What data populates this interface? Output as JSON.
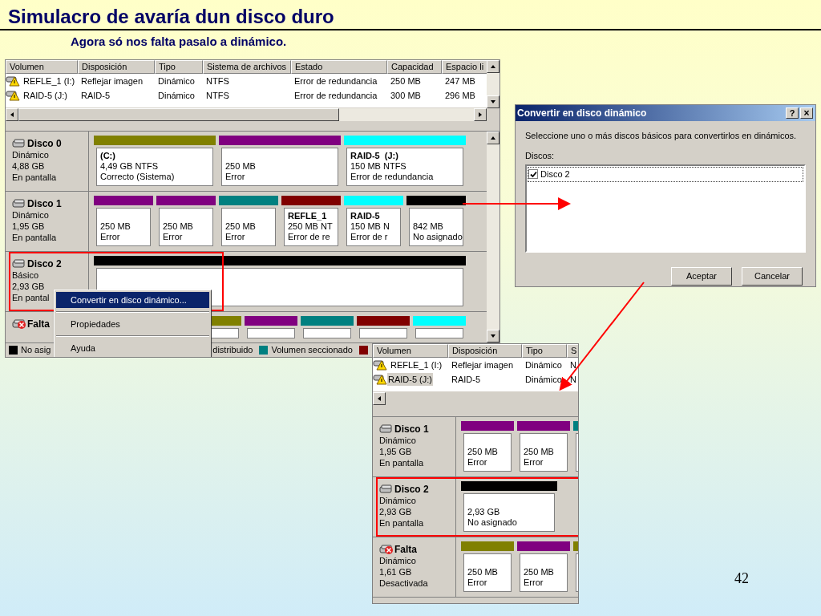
{
  "slide": {
    "title": "Simulacro de avaría dun disco duro",
    "subtitle": "Agora só nos falta pasalo a dinámico.",
    "page_number": "42"
  },
  "main_window": {
    "columns": [
      "Volumen",
      "Disposición",
      "Tipo",
      "Sistema de archivos",
      "Estado",
      "Capacidad",
      "Espacio li"
    ],
    "rows": [
      {
        "cells": [
          "REFLE_1 (I:)",
          "Reflejar imagen",
          "Dinámico",
          "NTFS",
          "Error de redundancia",
          "250 MB",
          "247 MB"
        ],
        "selected": false
      },
      {
        "cells": [
          "RAID-5 (J:)",
          "RAID-5",
          "Dinámico",
          "NTFS",
          "Error de redundancia",
          "300 MB",
          "296 MB"
        ],
        "selected": false
      }
    ],
    "disks": [
      {
        "name": "Disco 0",
        "missing": false,
        "highlighted": false,
        "lines": [
          "Dinámico",
          "4,88 GB",
          "En pantalla"
        ],
        "partitions": [
          {
            "color": "#808000",
            "title": "(C:)",
            "lines": [
              "4,49 GB NTFS",
              "Correcto (Sistema)"
            ]
          },
          {
            "color": "#800080",
            "lines": [
              "250 MB",
              "Error"
            ]
          },
          {
            "color": "#00ffff",
            "title": "RAID-5  (J:)",
            "lines": [
              "150 MB NTFS",
              "Error de redundancia"
            ]
          }
        ]
      },
      {
        "name": "Disco 1",
        "missing": false,
        "highlighted": false,
        "lines": [
          "Dinámico",
          "1,95 GB",
          "En pantalla"
        ],
        "partitions": [
          {
            "color": "#800080",
            "lines": [
              "250 MB",
              "Error"
            ]
          },
          {
            "color": "#800080",
            "lines": [
              "250 MB",
              "Error"
            ]
          },
          {
            "color": "#008080",
            "lines": [
              "250 MB",
              "Error"
            ]
          },
          {
            "color": "#800000",
            "title": "REFLE_1",
            "lines": [
              "250 MB NT",
              "Error de re"
            ]
          },
          {
            "color": "#00ffff",
            "title": "RAID-5",
            "lines": [
              "150 MB N",
              "Error de r"
            ]
          },
          {
            "color": "#000000",
            "lines": [
              "842 MB",
              "No asignado"
            ]
          }
        ]
      },
      {
        "name": "Disco 2",
        "missing": false,
        "highlighted": true,
        "lines": [
          "Básico",
          "2,93 GB",
          "En pantal"
        ],
        "partitions": [
          {
            "color": "#000000"
          }
        ]
      },
      {
        "name": "Falta",
        "missing": true,
        "highlighted": false,
        "partitions": [
          {
            "color": "#808000"
          },
          {
            "color": "#800080"
          },
          {
            "color": "#008080"
          },
          {
            "color": "#800000"
          },
          {
            "color": "#00ffff"
          }
        ]
      }
    ],
    "legend": [
      {
        "color": "#000000",
        "label": "No asig"
      },
      {
        "label": "distribuido"
      },
      {
        "color": "#008080",
        "label": "Volumen seccionado"
      },
      {
        "color": "#800000"
      }
    ],
    "context_menu": {
      "items": [
        {
          "label": "Convertir en disco dinámico...",
          "selected": true
        },
        {
          "label": "Propiedades",
          "selected": false
        },
        {
          "label": "Ayuda",
          "selected": false
        }
      ]
    }
  },
  "dialog": {
    "title": "Convertir en disco dinámico",
    "help": "?",
    "close": "×",
    "prompt": "Seleccione uno o más discos básicos para convertirlos en dinámicos.",
    "list_label": "Discos:",
    "disks": [
      {
        "label": "Disco 2",
        "checked": true
      }
    ],
    "buttons": [
      "Aceptar",
      "Cancelar"
    ]
  },
  "zoom_window": {
    "columns": [
      "Volumen",
      "Disposición",
      "Tipo",
      "S"
    ],
    "rows": [
      {
        "cells": [
          "REFLE_1 (I:)",
          "Reflejar imagen",
          "Dinámico",
          "N"
        ],
        "selected": false
      },
      {
        "cells": [
          "RAID-5 (J:)",
          "RAID-5",
          "Dinámico",
          "N"
        ],
        "selected": true
      }
    ],
    "disks": [
      {
        "name": "Disco 1",
        "missing": false,
        "highlighted": false,
        "lines": [
          "Dinámico",
          "1,95 GB",
          "En pantalla"
        ],
        "partitions": [
          {
            "color": "#800080",
            "lines": [
              "250 MB",
              "Error"
            ]
          },
          {
            "color": "#800080",
            "lines": [
              "250 MB",
              "Error"
            ]
          },
          {
            "color": "#008080"
          }
        ]
      },
      {
        "name": "Disco 2",
        "missing": false,
        "highlighted": true,
        "lines": [
          "Dinámico",
          "2,93 GB",
          "En pantalla"
        ],
        "partitions": [
          {
            "color": "#000000",
            "lines": [
              "2,93 GB",
              "No asignado"
            ]
          }
        ]
      },
      {
        "name": "Falta",
        "missing": true,
        "highlighted": false,
        "lines": [
          "Dinámico",
          "1,61 GB",
          "Desactivada"
        ],
        "partitions": [
          {
            "color": "#808000",
            "lines": [
              "250 MB",
              "Error"
            ]
          },
          {
            "color": "#800080",
            "lines": [
              "250 MB",
              "Error"
            ]
          },
          {
            "color": "#808000"
          }
        ]
      }
    ]
  }
}
